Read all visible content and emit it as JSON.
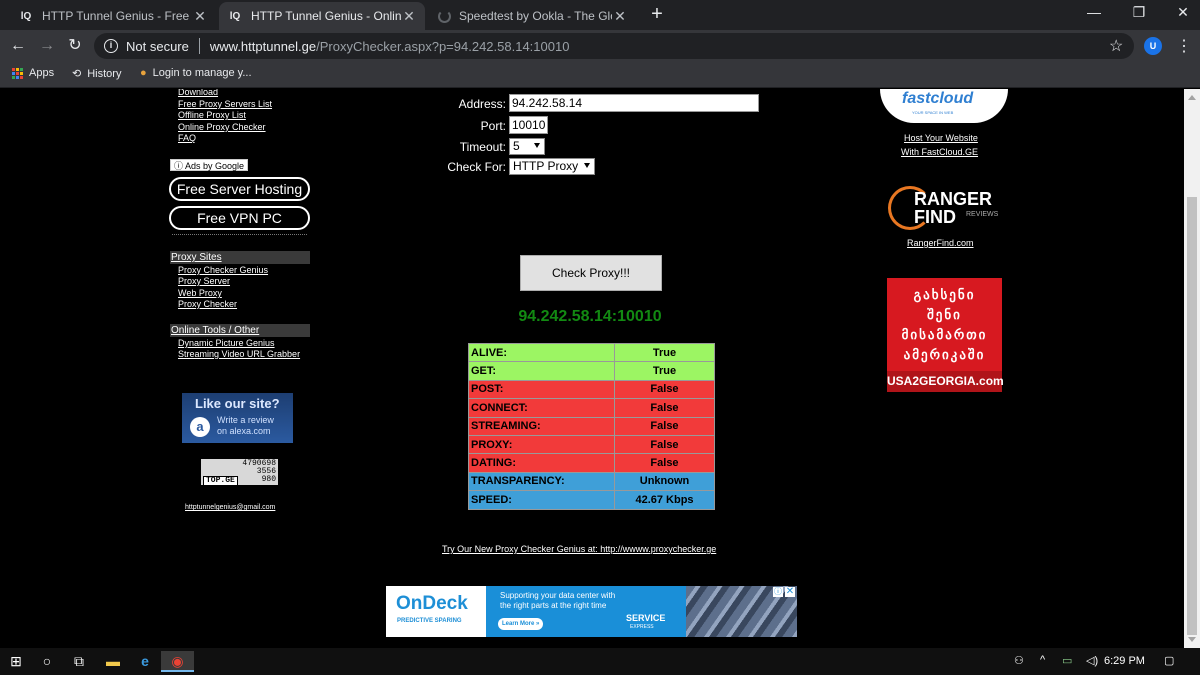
{
  "browser": {
    "tabs": [
      {
        "title": "HTTP Tunnel Genius - Free Public",
        "favicon": "httptunnel-icon",
        "active": false
      },
      {
        "title": "HTTP Tunnel Genius - Online Pro",
        "favicon": "httptunnel-icon",
        "active": true
      },
      {
        "title": "Speedtest by Ookla - The Global",
        "favicon": "loading-spinner-icon",
        "active": false
      }
    ],
    "close_glyph": "✕",
    "new_tab_glyph": "+",
    "window_controls": {
      "minimize": "—",
      "maximize": "❐",
      "close": "✕"
    },
    "nav": {
      "back": "←",
      "forward": "→",
      "reload": "↻"
    },
    "omnibox": {
      "security_label": "Not secure",
      "host": "www.httptunnel.ge",
      "path": "/ProxyChecker.aspx?p=94.242.58.14:10010"
    },
    "star_glyph": "☆",
    "profile_initial": "U",
    "menu_glyph": "⋮",
    "bookmarks": [
      {
        "label": "Apps",
        "icon": "apps-grid-icon"
      },
      {
        "label": "History",
        "icon": "history-icon"
      },
      {
        "label": "Login to manage y...",
        "icon": "bookmark-favicon-icon"
      }
    ]
  },
  "left_nav": {
    "links_top": [
      "Download",
      "Free Proxy Servers List",
      "Offline Proxy List",
      "Online Proxy Checker",
      "FAQ"
    ],
    "ads_by_google": "Ads by Google",
    "ad_buttons": [
      "Free Server Hosting",
      "Free VPN PC"
    ],
    "proxy_sites": {
      "heading": "Proxy Sites",
      "links": [
        "Proxy Checker Genius",
        "Proxy Server",
        "Web Proxy",
        "Proxy Checker"
      ]
    },
    "online_tools": {
      "heading": "Online Tools / Other",
      "links": [
        "Dynamic Picture Genius",
        "Streaming Video URL Grabber"
      ]
    },
    "alexa": {
      "title": "Like our site?",
      "line1": "Write a review",
      "line2": "on alexa.com",
      "letter": "a"
    },
    "topge": {
      "counts": [
        "4790698",
        "3556",
        "980"
      ],
      "label": "TOP.GE"
    },
    "email": "httptunnelgenius@gmail.com"
  },
  "form": {
    "address_label": "Address:",
    "address_value": "94.242.58.14",
    "port_label": "Port:",
    "port_value": "10010",
    "timeout_label": "Timeout:",
    "timeout_value": "5",
    "checkfor_label": "Check For:",
    "checkfor_value": "HTTP Proxy",
    "check_button": "Check Proxy!!!"
  },
  "result": {
    "proxy": "94.242.58.14:10010",
    "rows": [
      {
        "key": "ALIVE:",
        "value": "True",
        "status": "green"
      },
      {
        "key": "GET:",
        "value": "True",
        "status": "green"
      },
      {
        "key": "POST:",
        "value": "False",
        "status": "red"
      },
      {
        "key": "CONNECT:",
        "value": "False",
        "status": "red"
      },
      {
        "key": "STREAMING:",
        "value": "False",
        "status": "red"
      },
      {
        "key": "PROXY:",
        "value": "False",
        "status": "red"
      },
      {
        "key": "DATING:",
        "value": "False",
        "status": "red"
      },
      {
        "key": "TRANSPARENCY:",
        "value": "Unknown",
        "status": "blue"
      },
      {
        "key": "SPEED:",
        "value": "42.67 Kbps",
        "status": "blue"
      }
    ],
    "status_colors": {
      "green": "#9cf563",
      "red": "#f23a3a",
      "blue": "#3f9fd8"
    }
  },
  "try_link": "Try Our New Proxy Checker Genius at: http://wwww.proxychecker.ge",
  "ondeck_ad": {
    "brand": "OnDeck",
    "tagline": "PREDICTIVE SPARING",
    "line1": "Supporting your data center with",
    "line2": "the right parts at the right time",
    "cta": "Learn More »",
    "service": "SERVICE",
    "service_sub": "EXPRESS"
  },
  "right_col": {
    "fastcloud": {
      "logo": "fastcloud",
      "tag": "YOUR SPACE IN WEB",
      "link1": "Host Your Website",
      "link2": "With FastCloud.GE"
    },
    "ranger": {
      "line1": "RANGER",
      "line2": "FIND",
      "sub": "REVIEWS",
      "link": "RangerFind.com"
    },
    "usa2georgia": {
      "lines": [
        "გახსენი",
        "შენი",
        "მისამართი",
        "ამერიკაში"
      ],
      "footer": "USA2GEORGIA.com"
    }
  },
  "taskbar": {
    "time": "6:29 PM",
    "icons": [
      "windows-start-icon",
      "cortana-circle-icon",
      "task-view-icon",
      "file-explorer-icon",
      "edge-icon",
      "chrome-icon"
    ]
  }
}
